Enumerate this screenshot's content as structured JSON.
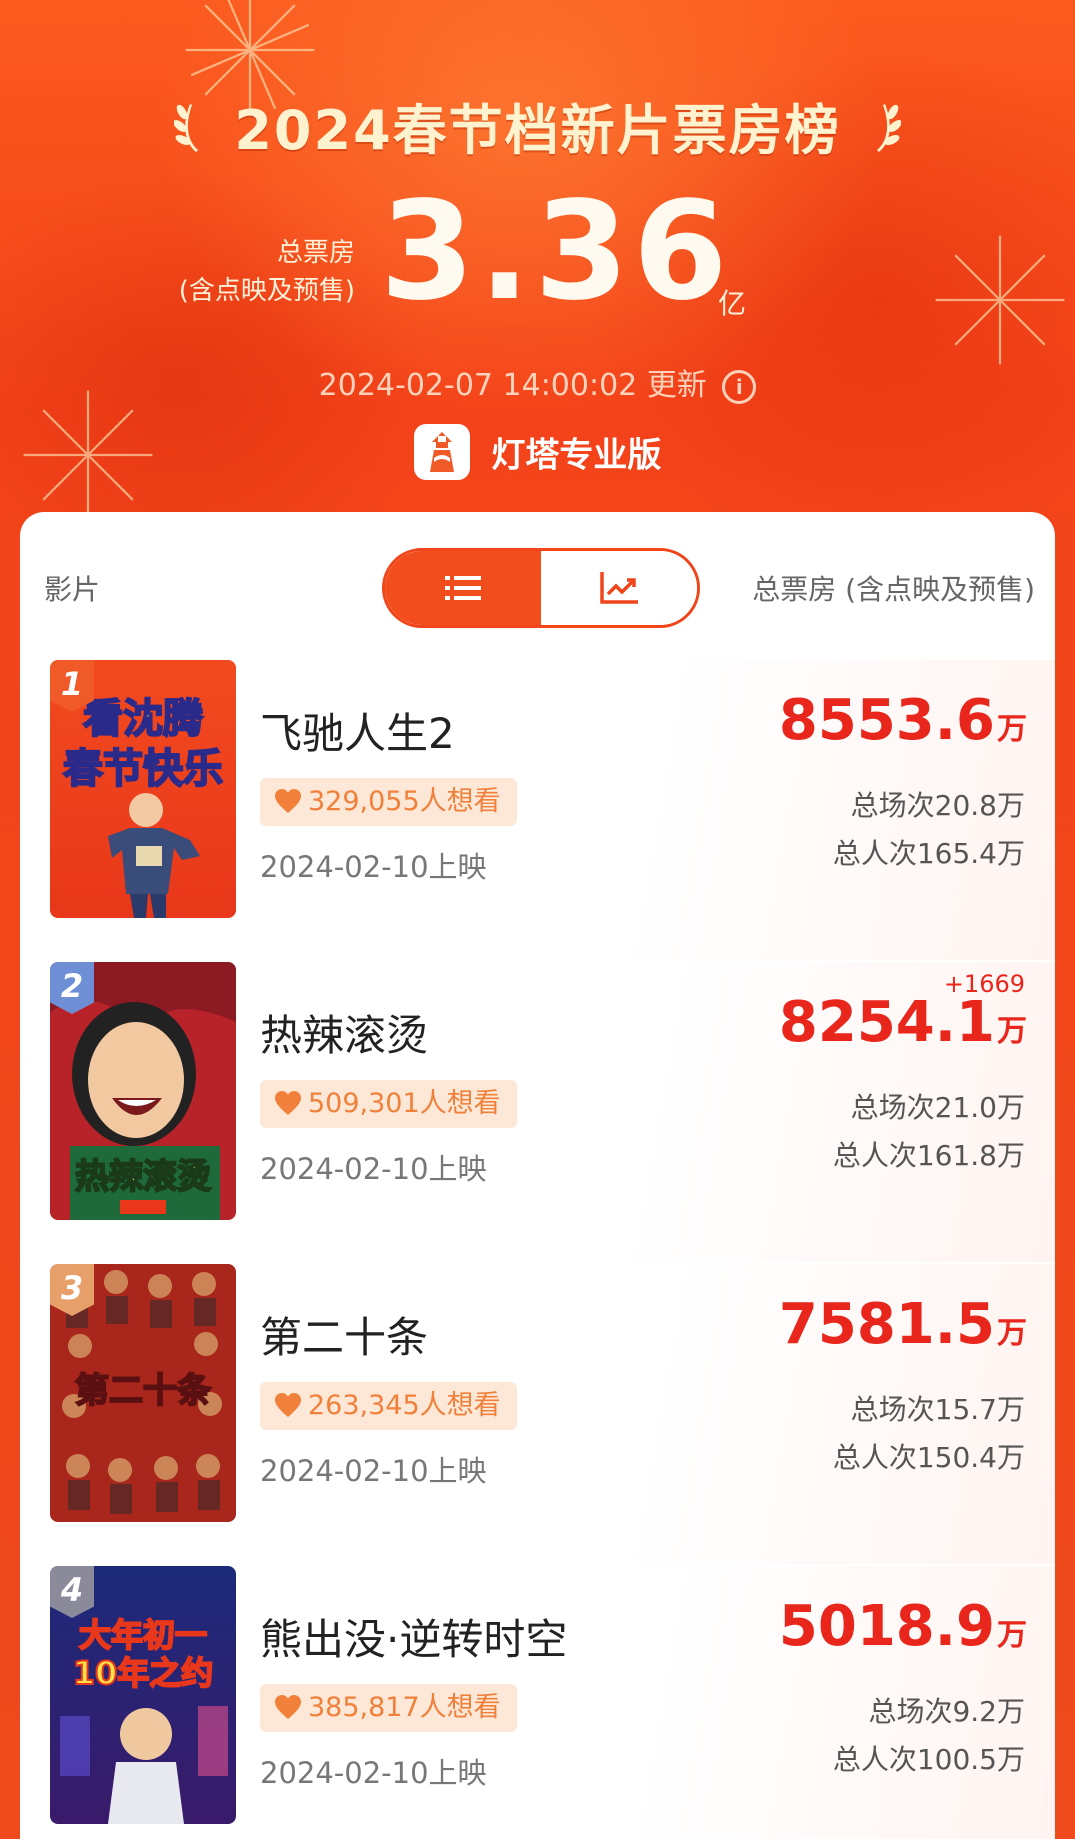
{
  "header": {
    "title": "2024春节档新片票房榜",
    "total_label_line1": "总票房",
    "total_label_line2": "(含点映及预售)",
    "total_value": "3.36",
    "total_unit": "亿",
    "update_time": "2024-02-07 14:00:02",
    "update_suffix": "更新",
    "brand_name": "灯塔专业版"
  },
  "table_header": {
    "left": "影片",
    "right": "总票房 (含点映及预售)",
    "view_toggle": {
      "selected": "list",
      "options": [
        "list-view-icon",
        "trend-chart-icon"
      ]
    }
  },
  "movies": [
    {
      "rank": "1",
      "name": "飞驰人生2",
      "want": "329,055人想看",
      "release": "2024-02-10上映",
      "box_office": "8553.6",
      "box_unit": "万",
      "delta": "",
      "screenings": "总场次20.8万",
      "admissions": "总人次165.4万",
      "rank_color": "#f05a28",
      "poster_text_1": "看沈腾",
      "poster_text_2": "春节快乐"
    },
    {
      "rank": "2",
      "name": "热辣滚烫",
      "want": "509,301人想看",
      "release": "2024-02-10上映",
      "box_office": "8254.1",
      "box_unit": "万",
      "delta": "+1669",
      "screenings": "总场次21.0万",
      "admissions": "总人次161.8万",
      "rank_color": "#6e8fd6",
      "poster_text_1": "热辣滚烫"
    },
    {
      "rank": "3",
      "name": "第二十条",
      "want": "263,345人想看",
      "release": "2024-02-10上映",
      "box_office": "7581.5",
      "box_unit": "万",
      "delta": "",
      "screenings": "总场次15.7万",
      "admissions": "总人次150.4万",
      "rank_color": "#e8a06a",
      "poster_text_1": "第二十条"
    },
    {
      "rank": "4",
      "name": "熊出没·逆转时空",
      "want": "385,817人想看",
      "release": "2024-02-10上映",
      "box_office": "5018.9",
      "box_unit": "万",
      "delta": "",
      "screenings": "总场次9.2万",
      "admissions": "总人次100.5万",
      "rank_color": "#8a8a9a",
      "poster_text_1": "大年初一",
      "poster_text_2": "10年之约"
    }
  ],
  "colors": {
    "brand_orange": "#f0451a",
    "box_red": "#e8261b",
    "badge_bg": "#fde8d8",
    "badge_text": "#f0803a"
  }
}
